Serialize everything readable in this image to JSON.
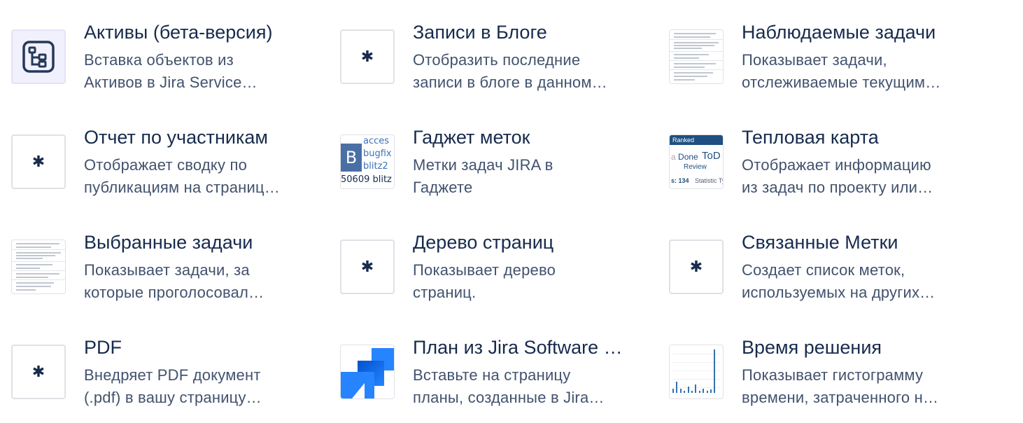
{
  "macros": [
    {
      "id": "assets",
      "title": "Активы (бета-версия)",
      "desc_line1": "Вставка объектов из",
      "desc_line2": "Активов в Jira Service…",
      "icon": "assets-hierarchy-icon"
    },
    {
      "id": "blog-posts",
      "title": "Записи в Блоге",
      "desc_line1": "Отобразить последние",
      "desc_line2": "записи в блоге в данном…",
      "icon": "asterisk-icon"
    },
    {
      "id": "watched-issues",
      "title": "Наблюдаемые задачи",
      "desc_line1": "Показывает задачи,",
      "desc_line2": "отслеживаемые текущим…",
      "icon": "issue-list-preview-icon"
    },
    {
      "id": "contributors-summary",
      "title": "Отчет по участникам",
      "desc_line1": "Отображает сводку по",
      "desc_line2": "публикациям на страниц…",
      "icon": "asterisk-icon"
    },
    {
      "id": "labels-gadget",
      "title": "Гаджет меток",
      "desc_line1": "Метки задач JIRA в",
      "desc_line2": "Гаджете",
      "icon": "labels-gadget-preview-icon",
      "preview_texts": [
        "acces",
        "bugfix",
        "blitz2",
        "50609 blitz",
        "B"
      ]
    },
    {
      "id": "heat-map",
      "title": "Тепловая карта",
      "desc_line1": "Отображает информацию",
      "desc_line2": "из задач по проекту или…",
      "icon": "heat-map-preview-icon",
      "preview_texts": [
        "Ranked",
        "Done",
        "ToD",
        "Review",
        "s: 134",
        "Statistic Typ"
      ]
    },
    {
      "id": "voted-issues",
      "title": "Выбранные задачи",
      "desc_line1": "Показывает задачи, за",
      "desc_line2": "которые проголосовал…",
      "icon": "issue-list-preview-icon"
    },
    {
      "id": "page-tree",
      "title": "Дерево страниц",
      "desc_line1": "Показывает дерево",
      "desc_line2": "страниц.",
      "icon": "asterisk-icon"
    },
    {
      "id": "related-labels",
      "title": "Связанные Метки",
      "desc_line1": "Создает список меток,",
      "desc_line2": "используемых на других…",
      "icon": "asterisk-icon"
    },
    {
      "id": "pdf",
      "title": "PDF",
      "desc_line1": "Внедряет PDF документ",
      "desc_line2": "(.pdf) в вашу страницу…",
      "icon": "asterisk-icon"
    },
    {
      "id": "jira-software-plan",
      "title": "План из Jira Software …",
      "desc_line1": "Вставьте на страницу",
      "desc_line2": "планы, созданные в Jira…",
      "icon": "jira-software-logo-icon"
    },
    {
      "id": "resolution-time",
      "title": "Время решения",
      "desc_line1": "Показывает гистограмму",
      "desc_line2": "времени, затраченного н…",
      "icon": "histogram-preview-icon",
      "histogram_levels": [
        0.1,
        0.25,
        0.1,
        0.05,
        0.15,
        0.05,
        0.2,
        0.05,
        0.1,
        0.05,
        0.08,
        1.0
      ]
    }
  ],
  "asterisk_glyph": "✱",
  "colors": {
    "title": "#172b4d",
    "description": "#42526e",
    "thumb_border": "#dfe1e6",
    "assets_bg": "#f1f0fd",
    "jira_blue": "#2684ff",
    "jira_blue_dark": "#0052cc"
  }
}
